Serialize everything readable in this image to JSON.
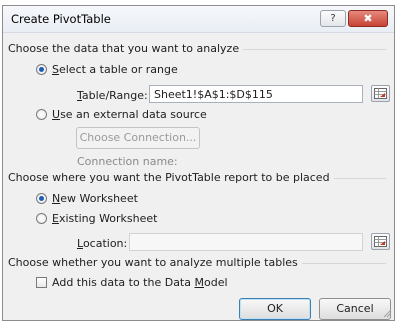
{
  "dialog": {
    "title": "Create PivotTable",
    "help_symbol": "?",
    "close_symbol": "✖"
  },
  "section_analyze": {
    "label": "Choose the data that you want to analyze"
  },
  "opt_select_range": {
    "label": "Select a table or range",
    "selected": true
  },
  "table_range": {
    "label": "Table/Range:",
    "value": "Sheet1!$A$1:$D$115"
  },
  "opt_external": {
    "label": "Use an external data source",
    "selected": false
  },
  "choose_connection": {
    "label": "Choose Connection..."
  },
  "connection_name": {
    "label": "Connection name:"
  },
  "section_place": {
    "label": "Choose where you want the PivotTable report to be placed"
  },
  "opt_new_ws": {
    "label": "New Worksheet",
    "selected": true
  },
  "opt_existing_ws": {
    "label": "Existing Worksheet",
    "selected": false
  },
  "location": {
    "label": "Location:",
    "value": ""
  },
  "section_multiple": {
    "label": "Choose whether you want to analyze multiple tables"
  },
  "data_model": {
    "label": "Add this data to the Data Model",
    "checked": false
  },
  "buttons": {
    "ok": "OK",
    "cancel": "Cancel"
  },
  "icons": {
    "help": "help-icon",
    "close": "close-icon",
    "collapse_range": "range-collapse-icon",
    "resize": "resize-grip-icon"
  }
}
